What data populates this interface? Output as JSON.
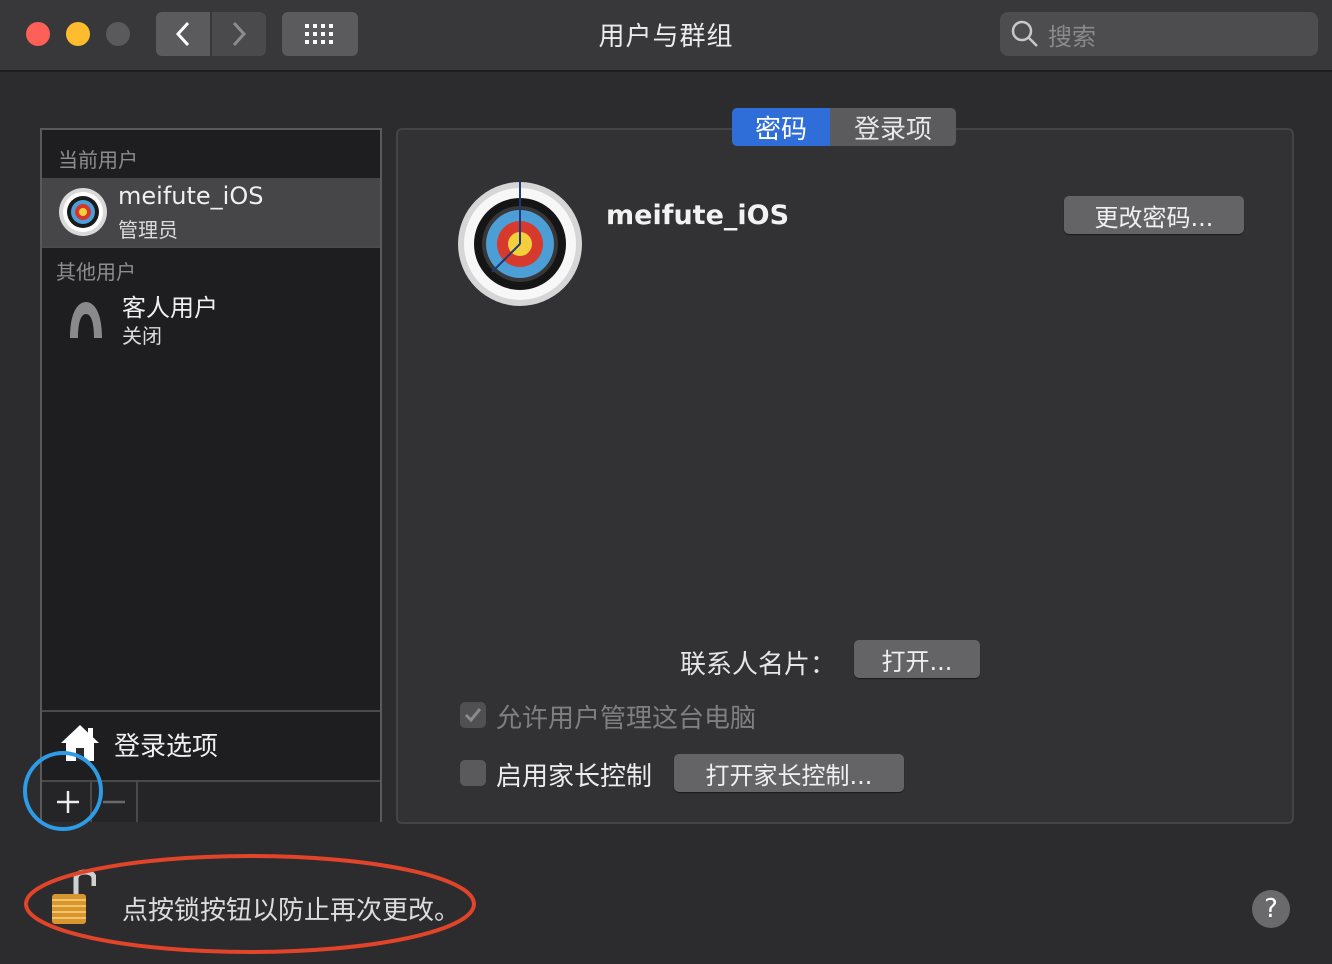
{
  "window": {
    "title": "用户与群组"
  },
  "search": {
    "placeholder": "搜索"
  },
  "sidebar": {
    "current_header": "当前用户",
    "current_user": {
      "name": "meifute_iOS",
      "role": "管理员"
    },
    "other_header": "其他用户",
    "guest_user": {
      "name": "客人用户",
      "status": "关闭"
    },
    "login_options": "登录选项",
    "add_label": "+",
    "remove_label": "—"
  },
  "tabs": [
    {
      "label": "密码"
    },
    {
      "label": "登录项"
    }
  ],
  "detail": {
    "username": "meifute_iOS",
    "change_password": "更改密码...",
    "contact_card_label": "联系人名片：",
    "open_button": "打开...",
    "allow_admin_label": "允许用户管理这台电脑",
    "parental_label": "启用家长控制",
    "open_parental_button": "打开家长控制..."
  },
  "footer": {
    "lock_text": "点按锁按钮以防止再次更改。",
    "help": "?"
  },
  "annotations": {
    "circle_color": "#2e9be6",
    "ellipse_color": "#e2442a"
  }
}
